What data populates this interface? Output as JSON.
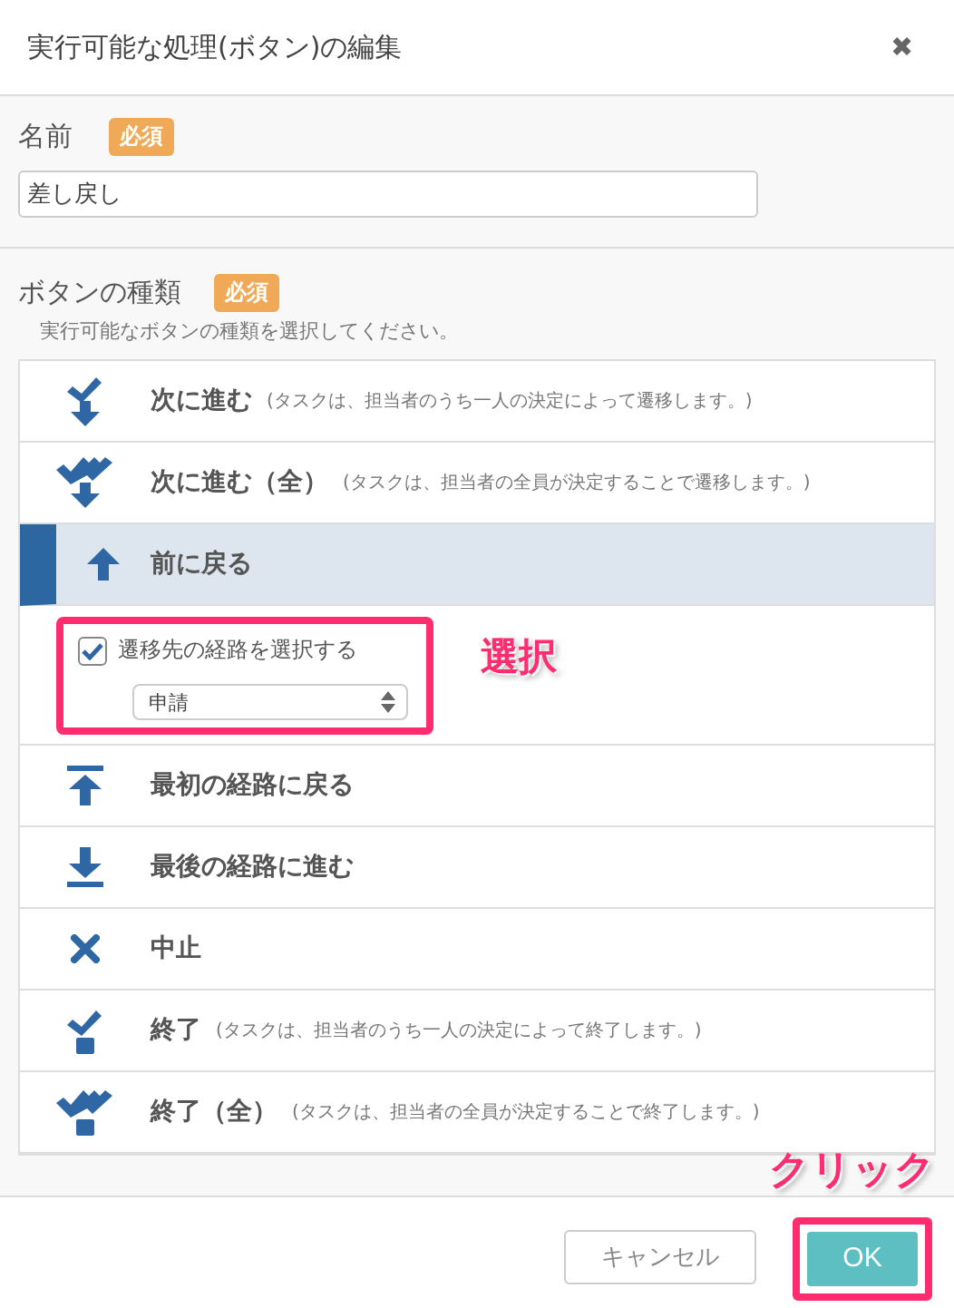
{
  "dialog": {
    "title": "実行可能な処理(ボタン)の編集",
    "close": "✖"
  },
  "name_field": {
    "label": "名前",
    "badge": "必須",
    "value": "差し戻し"
  },
  "button_type": {
    "label": "ボタンの種類",
    "badge": "必須",
    "help": "実行可能なボタンの種類を選択してください。"
  },
  "options": [
    {
      "kind": "next",
      "label": "次に進む",
      "note": "(タスクは、担当者のうち一人の決定によって遷移します。)",
      "selected": false
    },
    {
      "kind": "next_all",
      "label": "次に進む（全）",
      "note": "(タスクは、担当者の全員が決定することで遷移します。)",
      "selected": false
    },
    {
      "kind": "back",
      "label": "前に戻る",
      "selected": true,
      "sub": {
        "checkbox_label": "遷移先の経路を選択する",
        "checked": true,
        "route": "申請",
        "callout": "選択"
      }
    },
    {
      "kind": "first",
      "label": "最初の経路に戻る",
      "selected": false
    },
    {
      "kind": "last",
      "label": "最後の経路に進む",
      "selected": false
    },
    {
      "kind": "cancel",
      "label": "中止",
      "selected": false
    },
    {
      "kind": "end",
      "label": "終了",
      "note": "(タスクは、担当者のうち一人の決定によって終了します。)",
      "selected": false
    },
    {
      "kind": "end_all",
      "label": "終了（全）",
      "note": "(タスクは、担当者の全員が決定することで終了します。)",
      "selected": false
    }
  ],
  "footer": {
    "cancel": "キャンセル",
    "ok": "OK",
    "callout": "クリック"
  }
}
